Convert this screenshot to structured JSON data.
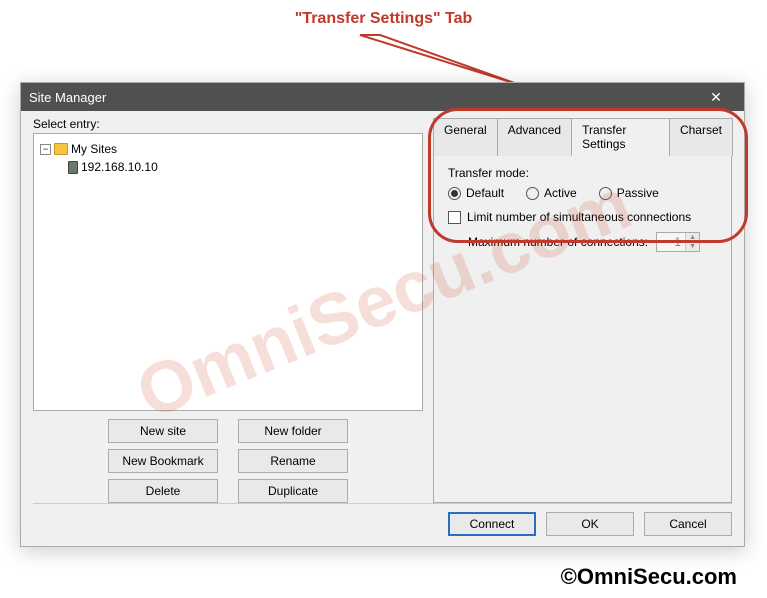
{
  "annotation": {
    "label": "\"Transfer Settings\" Tab"
  },
  "watermark": {
    "diagonal": "OmniSecu.com",
    "footer": "©OmniSecu.com"
  },
  "window": {
    "title": "Site Manager"
  },
  "left": {
    "select_label": "Select entry:",
    "tree": {
      "root": "My Sites",
      "child": "192.168.10.10"
    },
    "buttons": {
      "new_site": "New site",
      "new_folder": "New folder",
      "new_bookmark": "New Bookmark",
      "rename": "Rename",
      "delete": "Delete",
      "duplicate": "Duplicate"
    }
  },
  "tabs": {
    "general": "General",
    "advanced": "Advanced",
    "transfer_settings": "Transfer Settings",
    "charset": "Charset"
  },
  "panel": {
    "transfer_mode_label": "Transfer mode:",
    "modes": {
      "default": "Default",
      "active": "Active",
      "passive": "Passive",
      "selected": "default"
    },
    "limit_checkbox_label": "Limit number of simultaneous connections",
    "limit_checked": false,
    "max_conn_label": "Maximum number of connections:",
    "max_conn_value": "1"
  },
  "bottom": {
    "connect": "Connect",
    "ok": "OK",
    "cancel": "Cancel"
  }
}
